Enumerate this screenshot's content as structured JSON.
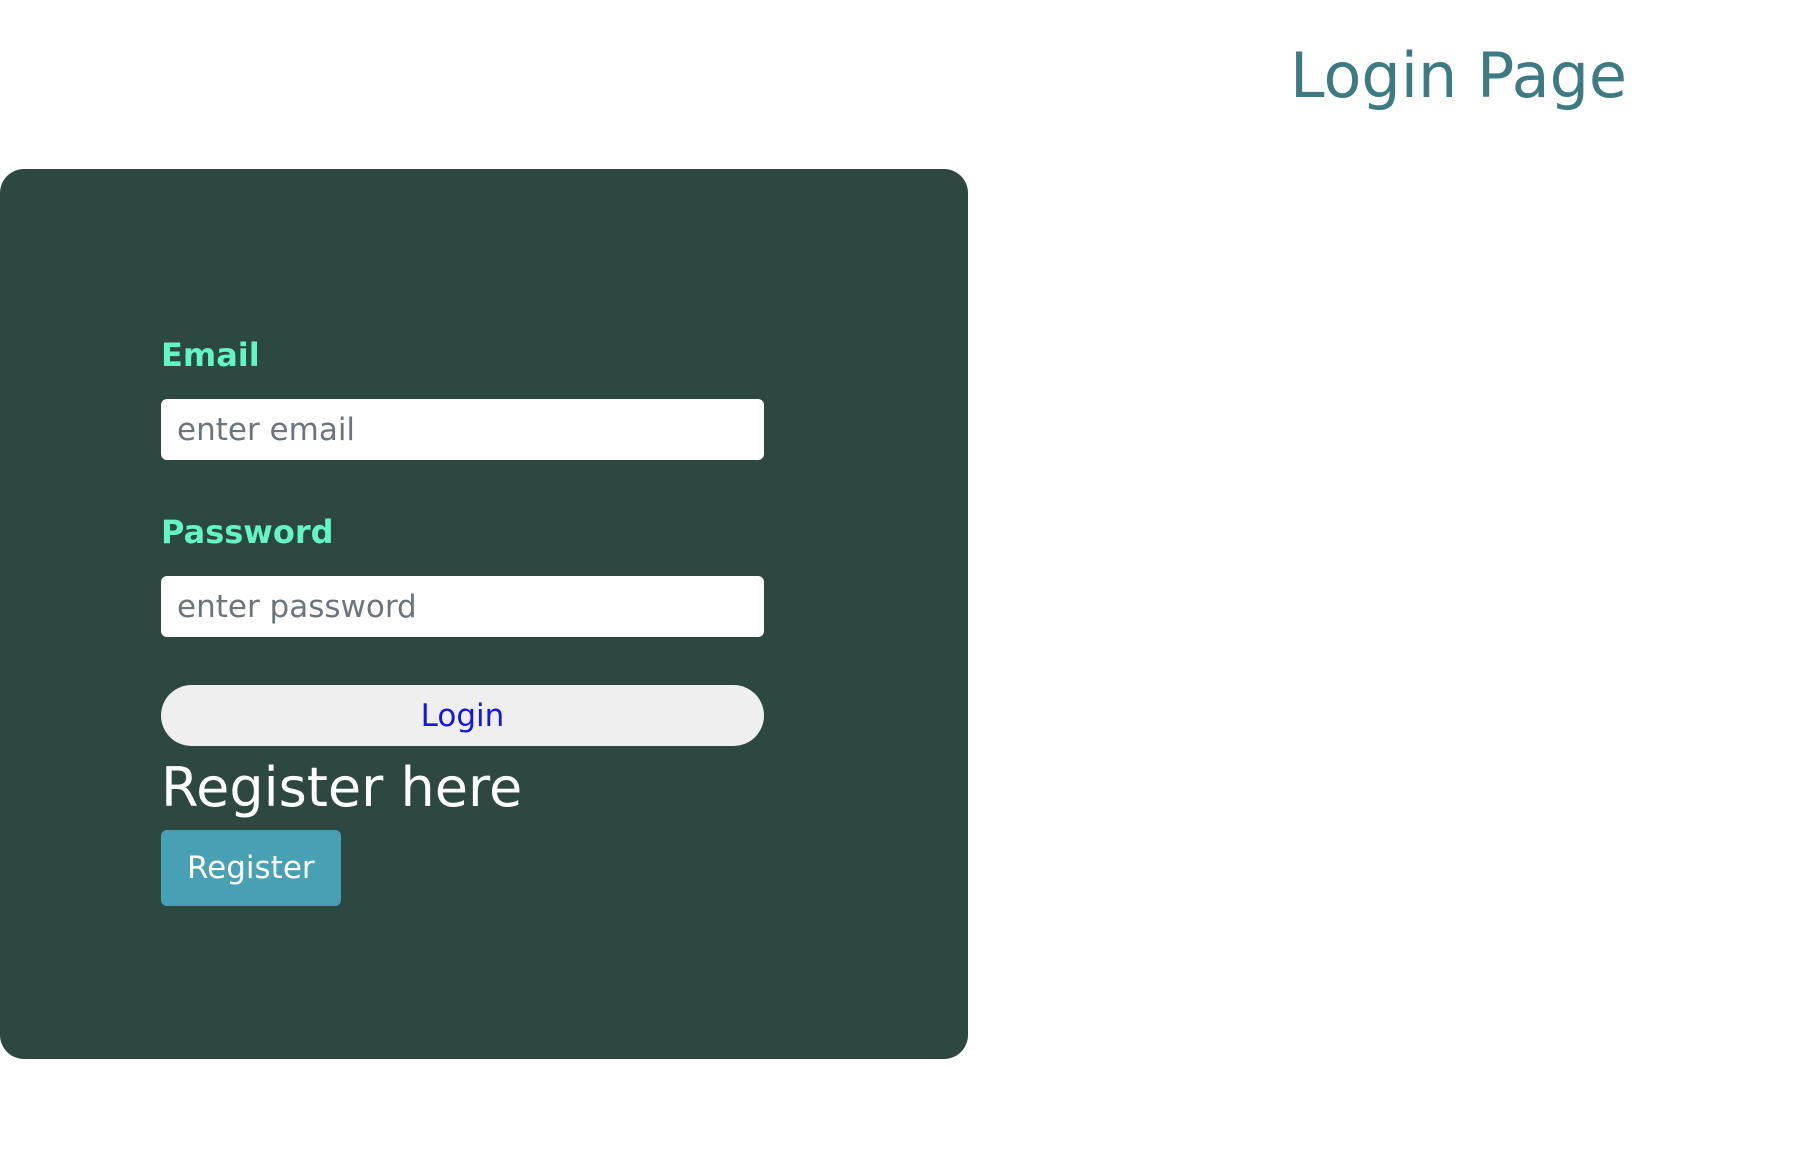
{
  "header": {
    "title": "Login Page"
  },
  "login_form": {
    "email_label": "Email",
    "email_placeholder": "enter email",
    "email_value": "",
    "password_label": "Password",
    "password_placeholder": "enter password",
    "password_value": "",
    "login_button_label": "Login"
  },
  "register": {
    "heading": "Register here",
    "button_label": "Register"
  },
  "colors": {
    "title": "#3d7a84",
    "card_background": "#2d4741",
    "label_accent": "#64f5c5",
    "login_button_background": "#efefef",
    "login_button_text": "#1217e6",
    "register_button_background": "#48a0b4"
  }
}
